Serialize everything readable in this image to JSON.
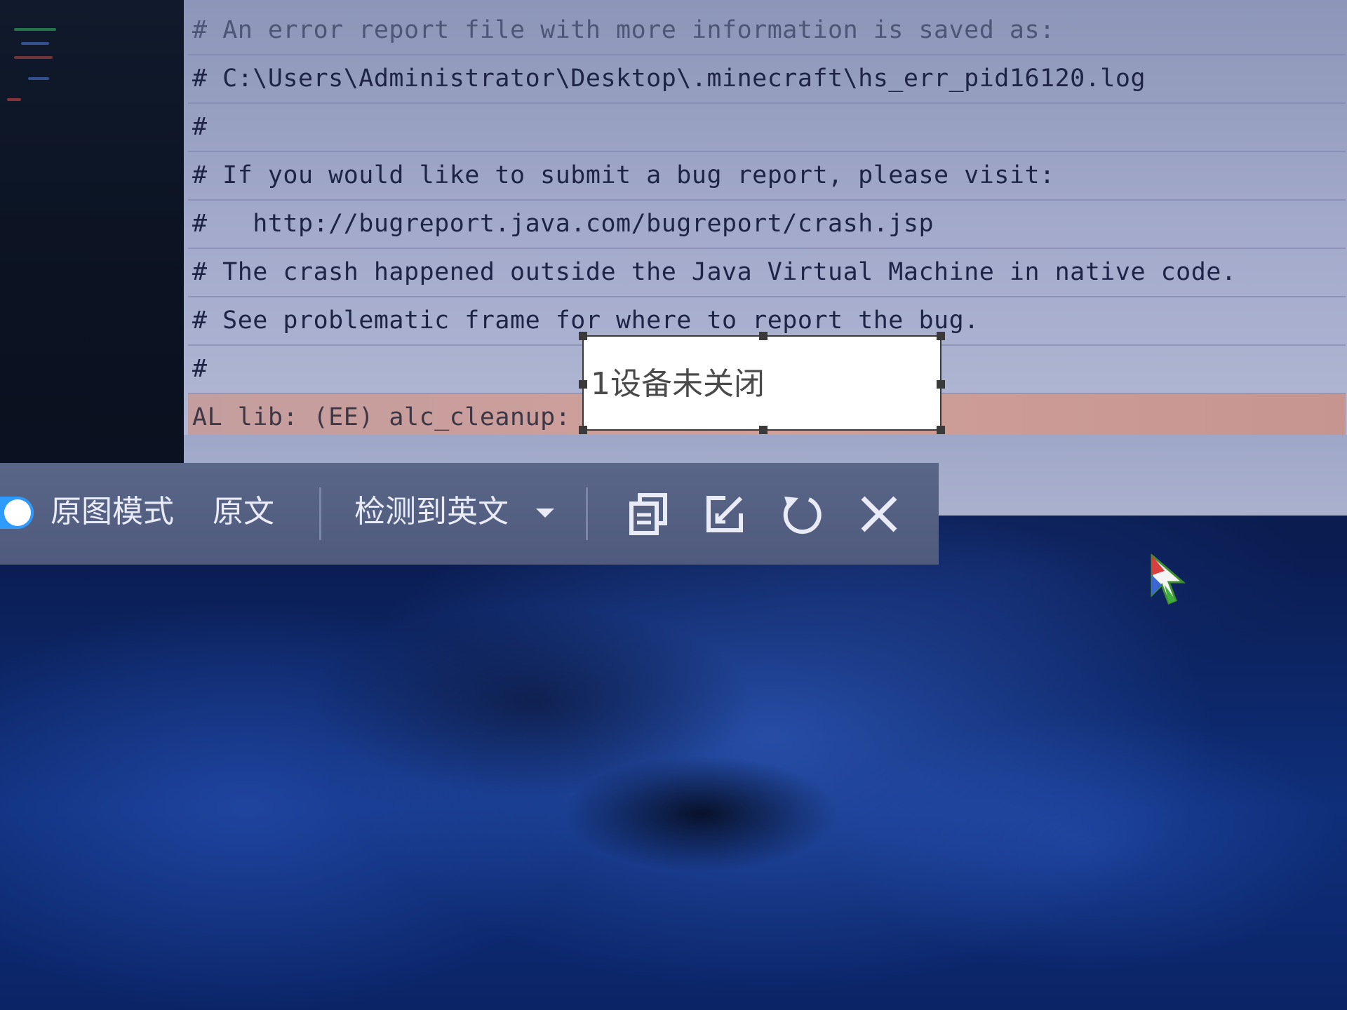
{
  "console": {
    "lines": [
      "# An error report file with more information is saved as:",
      "# C:\\Users\\Administrator\\Desktop\\.minecraft\\hs_err_pid16120.log",
      "#",
      "# If you would like to submit a bug report, please visit:",
      "#   http://bugreport.java.com/bugreport/crash.jsp",
      "# The crash happened outside the Java Virtual Machine in native code.",
      "# See problematic frame for where to report the bug.",
      "#",
      "AL lib: (EE) alc_cleanup:"
    ]
  },
  "overlay": {
    "translated_text": "1设备未关闭"
  },
  "toolbar": {
    "toggle_on": true,
    "mode_label": "原图模式",
    "original_label": "原文",
    "detected_language_label": "检测到英文",
    "icons": {
      "copy": "copy-icon",
      "edit": "edit-icon",
      "refresh": "refresh-icon",
      "close": "close-icon"
    }
  },
  "colors": {
    "toggle_accent": "#2f9bff",
    "highlight_row": "#cf9f99",
    "toolbar_bg": "#55617f"
  }
}
